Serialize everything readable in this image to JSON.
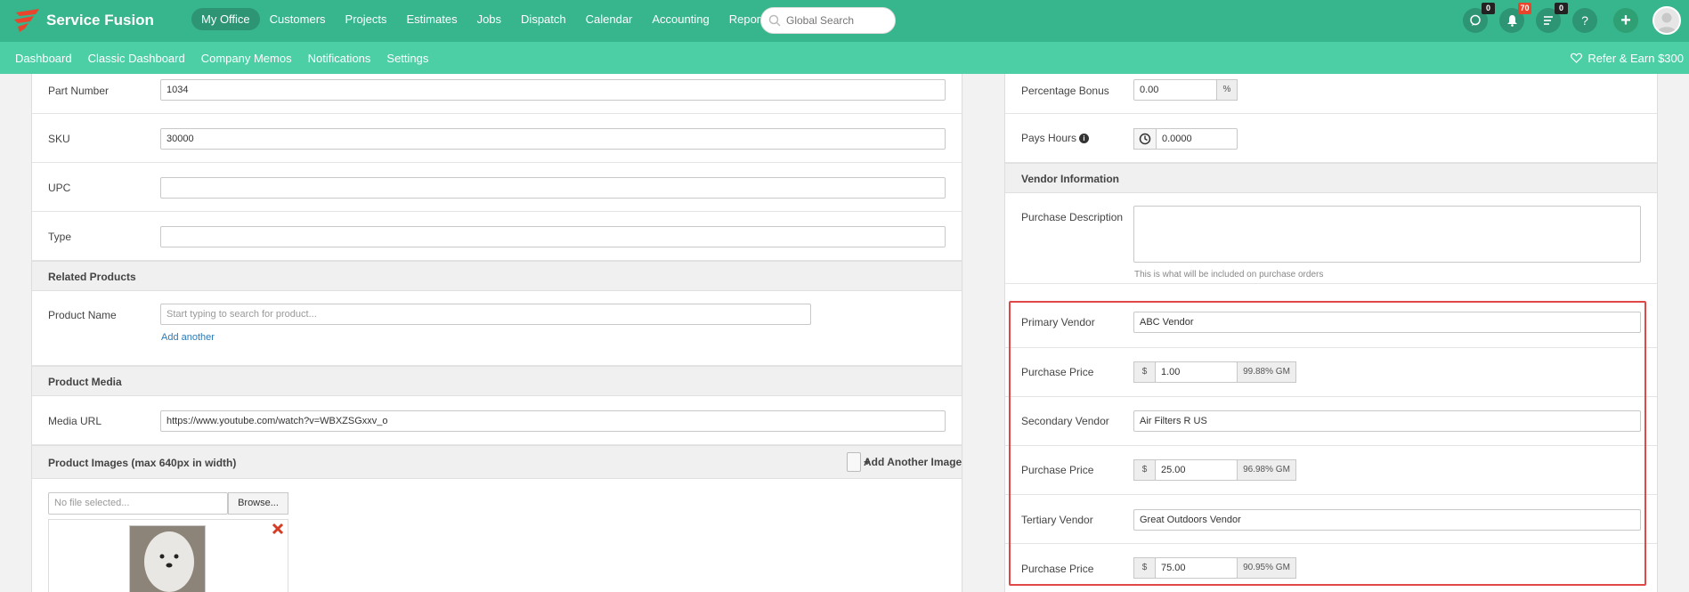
{
  "app": {
    "name": "Service Fusion"
  },
  "nav": {
    "items": [
      "My Office",
      "Customers",
      "Projects",
      "Estimates",
      "Jobs",
      "Dispatch",
      "Calendar",
      "Accounting",
      "Reports"
    ],
    "active": "My Office"
  },
  "search": {
    "placeholder": "Global Search"
  },
  "header_icons": {
    "chat_count": "0",
    "notifications_count": "70",
    "tasks_count": "0",
    "help": "?",
    "add": "+"
  },
  "subnav": {
    "items": [
      "Dashboard",
      "Classic Dashboard",
      "Company Memos",
      "Notifications",
      "Settings"
    ],
    "refer": "Refer & Earn $300"
  },
  "left": {
    "part_number": {
      "label": "Part Number",
      "value": "1034"
    },
    "sku": {
      "label": "SKU",
      "value": "30000"
    },
    "upc": {
      "label": "UPC",
      "value": ""
    },
    "type": {
      "label": "Type",
      "value": ""
    },
    "related_products": {
      "title": "Related Products",
      "product_name_label": "Product Name",
      "product_name_placeholder": "Start typing to search for product...",
      "add_another": "Add another"
    },
    "product_media": {
      "title": "Product Media",
      "media_url_label": "Media URL",
      "media_url_value": "https://www.youtube.com/watch?v=WBXZSGxxv_o"
    },
    "product_images": {
      "title": "Product Images (max 640px in width)",
      "add_button": "Add Another Image",
      "file_placeholder": "No file selected...",
      "browse": "Browse..."
    }
  },
  "right": {
    "percentage_bonus": {
      "label": "Percentage Bonus",
      "value": "0.00",
      "suffix": "%"
    },
    "pays_hours": {
      "label": "Pays Hours",
      "value": "0.0000"
    },
    "vendor_information": {
      "title": "Vendor Information",
      "purchase_description_label": "Purchase Description",
      "purchase_description_value": "",
      "purchase_description_help": "This is what will be included on purchase orders"
    },
    "vendors": [
      {
        "vendor_label": "Primary Vendor",
        "vendor_value": "ABC Vendor",
        "price_label": "Purchase Price",
        "currency": "$",
        "price": "1.00",
        "gm": "99.88% GM"
      },
      {
        "vendor_label": "Secondary Vendor",
        "vendor_value": "Air Filters R US",
        "price_label": "Purchase Price",
        "currency": "$",
        "price": "25.00",
        "gm": "96.98% GM"
      },
      {
        "vendor_label": "Tertiary Vendor",
        "vendor_value": "Great Outdoors Vendor",
        "price_label": "Purchase Price",
        "currency": "$",
        "price": "75.00",
        "gm": "90.95% GM"
      }
    ]
  },
  "colors": {
    "topbar": "#37b58c",
    "subbar": "#4ccfa4",
    "highlight": "#e04848",
    "link": "#2a7ab8"
  }
}
